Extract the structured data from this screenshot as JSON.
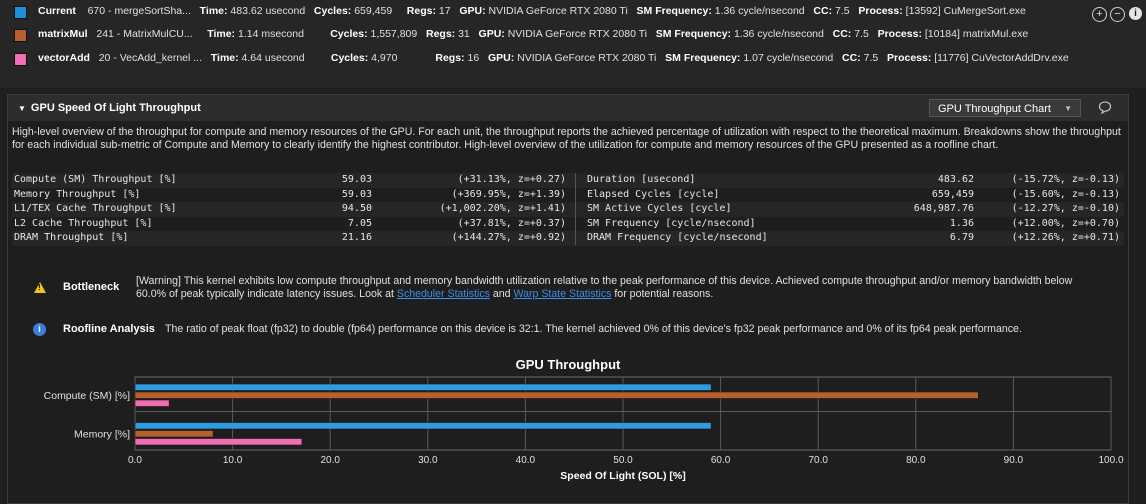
{
  "results": [
    {
      "color": "#1e90d6",
      "name": "Current",
      "kernel": "670 - mergeSortSha...",
      "time_label": "Time:",
      "time": "483.62 usecond",
      "cycles_label": "Cycles:",
      "cycles": "659,459",
      "regs_label": "Regs:",
      "regs": "17",
      "gpu_label": "GPU:",
      "gpu": "NVIDIA GeForce RTX 2080 Ti",
      "smf_label": "SM Frequency:",
      "smf": "1.36 cycle/nsecond",
      "cc_label": "CC:",
      "cc": "7.5",
      "proc_label": "Process:",
      "proc": "[13592] CuMergeSort.exe"
    },
    {
      "color": "#b5602e",
      "name": "matrixMul",
      "kernel": "241 - MatrixMulCU...",
      "time_label": "Time:",
      "time": "1.14 msecond",
      "cycles_label": "Cycles:",
      "cycles": "1,557,809",
      "regs_label": "Regs:",
      "regs": "31",
      "gpu_label": "GPU:",
      "gpu": "NVIDIA GeForce RTX 2080 Ti",
      "smf_label": "SM Frequency:",
      "smf": "1.36 cycle/nsecond",
      "cc_label": "CC:",
      "cc": "7.5",
      "proc_label": "Process:",
      "proc": "[10184] matrixMul.exe"
    },
    {
      "color": "#f06eb4",
      "name": "vectorAdd",
      "kernel": "20 - VecAdd_kernel ...",
      "time_label": "Time:",
      "time": "4.64 usecond",
      "cycles_label": "Cycles:",
      "cycles": "4,970",
      "regs_label": "Regs:",
      "regs": "16",
      "gpu_label": "GPU:",
      "gpu": "NVIDIA GeForce RTX 2080 Ti",
      "smf_label": "SM Frequency:",
      "smf": "1.07 cycle/nsecond",
      "cc_label": "CC:",
      "cc": "7.5",
      "proc_label": "Process:",
      "proc": "[11776] CuVectorAddDrv.exe"
    }
  ],
  "controls": {
    "add": "+",
    "remove": "−",
    "info": "i"
  },
  "section": {
    "title": "GPU Speed Of Light Throughput",
    "chart_select": "GPU Throughput Chart",
    "description": "High-level overview of the throughput for compute and memory resources of the GPU. For each unit, the throughput reports the achieved percentage of utilization with respect to the theoretical maximum. Breakdowns show the throughput for each individual sub-metric of Compute and Memory to clearly identify the highest contributor. High-level overview of the utilization for compute and memory resources of the GPU presented as a roofline chart."
  },
  "metrics_left": [
    {
      "name": "Compute (SM) Throughput [%]",
      "value": "59.03",
      "delta": "(+31.13%, z=+0.27)"
    },
    {
      "name": "Memory Throughput [%]",
      "value": "59.03",
      "delta": "(+369.95%, z=+1.39)"
    },
    {
      "name": "L1/TEX Cache Throughput [%]",
      "value": "94.50",
      "delta": "(+1,002.20%, z=+1.41)"
    },
    {
      "name": "L2 Cache Throughput [%]",
      "value": "7.05",
      "delta": "(+37.81%, z=+0.37)"
    },
    {
      "name": "DRAM Throughput [%]",
      "value": "21.16",
      "delta": "(+144.27%, z=+0.92)"
    }
  ],
  "metrics_right": [
    {
      "name": "Duration [usecond]",
      "value": "483.62",
      "delta": "(-15.72%, z=-0.13)"
    },
    {
      "name": "Elapsed Cycles [cycle]",
      "value": "659,459",
      "delta": "(-15.60%, z=-0.13)"
    },
    {
      "name": "SM Active Cycles [cycle]",
      "value": "648,987.76",
      "delta": "(-12.27%, z=-0.10)"
    },
    {
      "name": "SM Frequency [cycle/nsecond]",
      "value": "1.36",
      "delta": "(+12.00%, z=+0.70)"
    },
    {
      "name": "DRAM Frequency [cycle/nsecond]",
      "value": "6.79",
      "delta": "(+12.26%, z=+0.71)"
    }
  ],
  "bottleneck": {
    "label": "Bottleneck",
    "text_before": "[Warning] This kernel exhibits low compute throughput and memory bandwidth utilization relative to the peak performance of this device. Achieved compute throughput and/or memory bandwidth below 60.0% of peak typically indicate latency issues. Look at ",
    "link1": "Scheduler Statistics",
    "text_mid": " and ",
    "link2": "Warp State Statistics",
    "text_after": " for potential reasons."
  },
  "roofline": {
    "label": "Roofline Analysis",
    "text": "The ratio of peak float (fp32) to double (fp64) performance on this device is 32:1. The kernel achieved 0% of this device's fp32 peak performance and 0% of its fp64 peak performance."
  },
  "chart_data": {
    "type": "bar",
    "orientation": "horizontal",
    "title": "GPU Throughput",
    "xlabel": "Speed Of Light (SOL) [%]",
    "ylabel": "",
    "categories": [
      "Compute (SM) [%]",
      "Memory [%]"
    ],
    "xlim": [
      0,
      100
    ],
    "xticks": [
      "0.0",
      "10.0",
      "20.0",
      "30.0",
      "40.0",
      "50.0",
      "60.0",
      "70.0",
      "80.0",
      "90.0",
      "100.0"
    ],
    "grid": true,
    "series": [
      {
        "name": "Current",
        "color": "#2f9be0",
        "values": [
          59.03,
          59.03
        ]
      },
      {
        "name": "matrixMul",
        "color": "#b5602e",
        "values": [
          86.4,
          8.0
        ]
      },
      {
        "name": "vectorAdd",
        "color": "#f06eb4",
        "values": [
          3.5,
          17.1
        ]
      }
    ]
  }
}
